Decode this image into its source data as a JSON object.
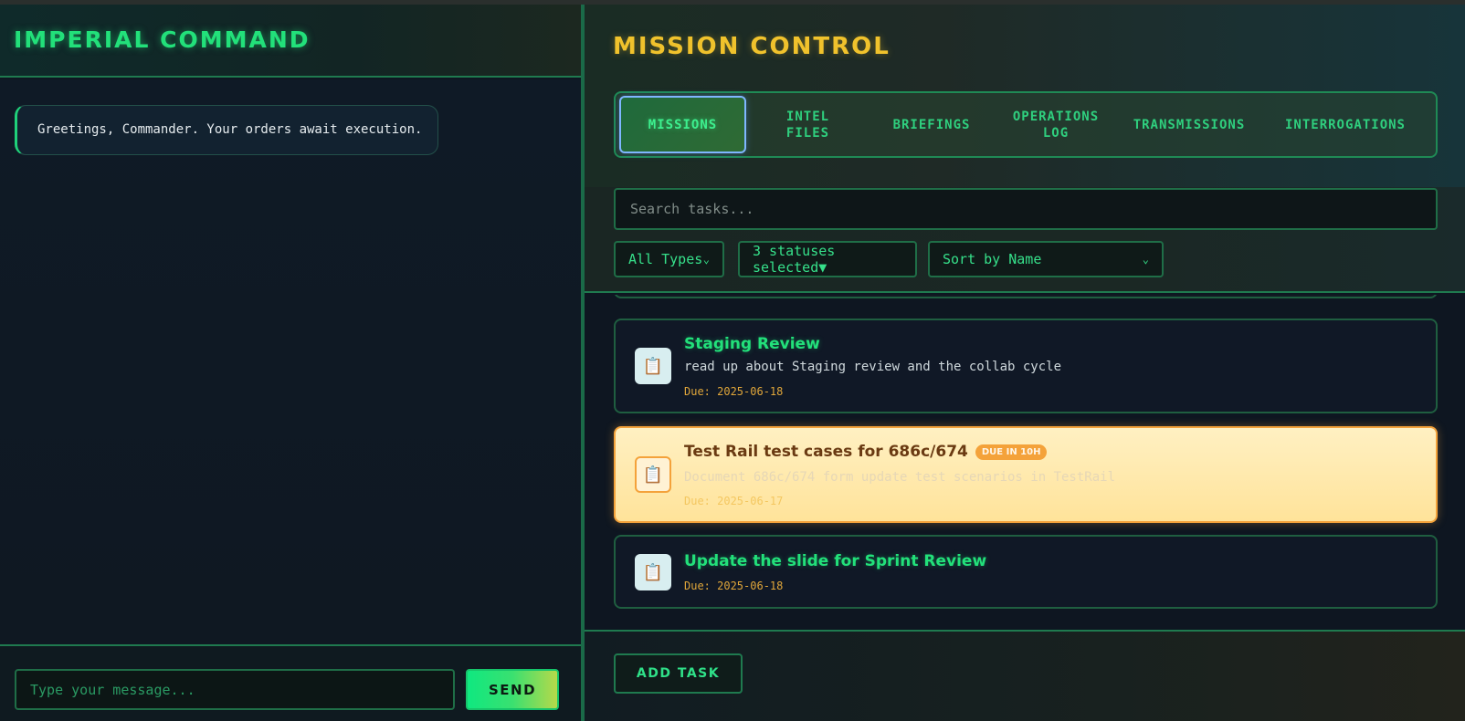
{
  "left": {
    "title": "IMPERIAL COMMAND",
    "message": "Greetings, Commander. Your orders await execution.",
    "input_placeholder": "Type your message...",
    "send_label": "SEND"
  },
  "right": {
    "title": "MISSION CONTROL",
    "tabs": [
      {
        "label": "MISSIONS",
        "active": true
      },
      {
        "label": "INTEL FILES",
        "active": false
      },
      {
        "label": "BRIEFINGS",
        "active": false
      },
      {
        "label": "OPERATIONS LOG",
        "active": false
      },
      {
        "label": "TRANSMISSIONS",
        "active": false
      },
      {
        "label": "INTERROGATIONS",
        "active": false
      }
    ],
    "search_placeholder": "Search tasks...",
    "filters": {
      "type": "All Types",
      "status": "3 statuses selected▼",
      "sort": "Sort by Name"
    },
    "tasks": [
      {
        "title": "Staging Review",
        "description": "read up about Staging review and the collab cycle",
        "due": "Due: 2025-06-18",
        "icon": "clipboard-icon"
      },
      {
        "title": "Test Rail test cases for 686c/674",
        "badge": "DUE IN 10H",
        "description": "Document 686c/674 form update test scenarios in TestRail",
        "due": "Due: 2025-06-17",
        "icon": "clipboard-icon",
        "highlighted": true
      },
      {
        "title": "Update the slide for Sprint Review",
        "due": "Due: 2025-06-18",
        "icon": "clipboard-icon"
      }
    ],
    "add_task_label": "ADD TASK"
  },
  "colors": {
    "accent_green": "#22e07a",
    "accent_gold": "#f0c22c",
    "highlight_orange": "#f4a23a"
  }
}
